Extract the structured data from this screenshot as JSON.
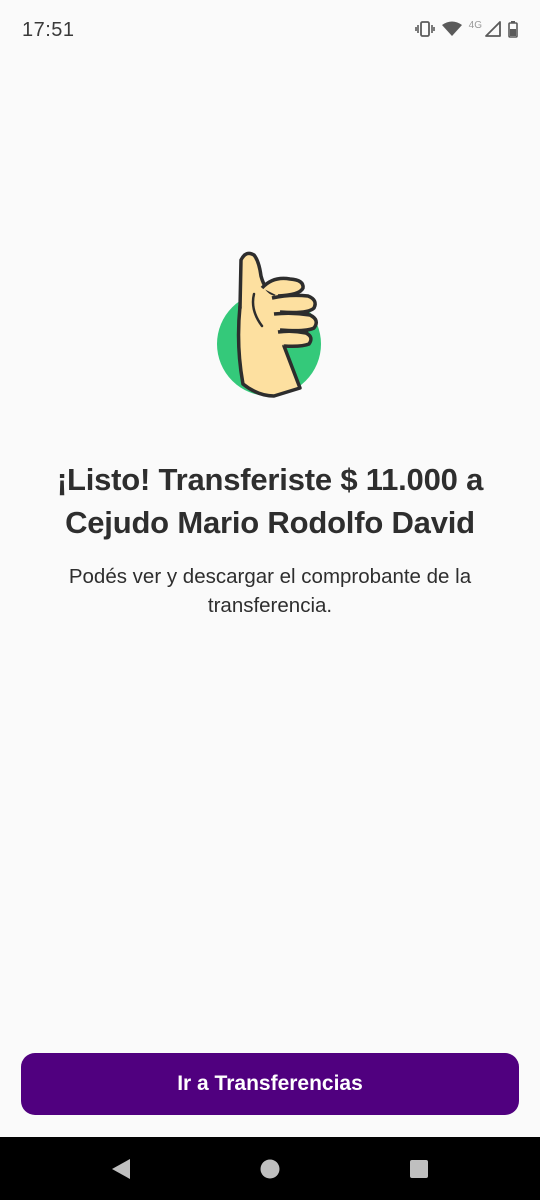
{
  "status_bar": {
    "time": "17:51",
    "network_label": "4G",
    "icons": [
      "vibrate-icon",
      "wifi-icon",
      "signal-icon",
      "battery-icon"
    ]
  },
  "illustration": {
    "icon": "thumbs-up-icon",
    "circle_color": "#34c97a",
    "skin_color": "#fde0a0"
  },
  "main": {
    "title": "¡Listo! Transferiste $ 11.000 a Cejudo Mario Rodolfo David",
    "subtitle": "Podés ver y descargar el comprobante de la transferencia."
  },
  "actions": {
    "primary_label": "Ir a Transferencias",
    "primary_color": "#50007f"
  },
  "nav_bar": {
    "icons": [
      "back-icon",
      "home-icon",
      "recents-icon"
    ]
  }
}
